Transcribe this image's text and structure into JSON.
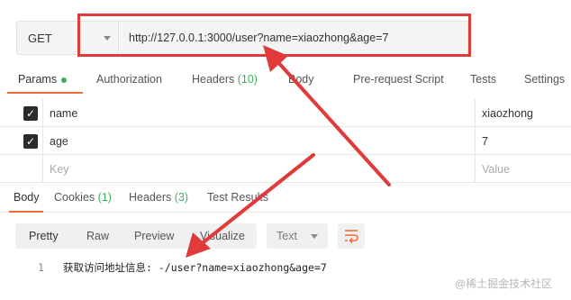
{
  "request": {
    "method": "GET",
    "url": "http://127.0.0.1:3000/user?name=xiaozhong&age=7"
  },
  "request_tabs": [
    {
      "label": "Params",
      "has_dot": true
    },
    {
      "label": "Authorization"
    },
    {
      "label": "Headers",
      "count": "(10)"
    },
    {
      "label": "Body"
    },
    {
      "label": "Pre-request Script"
    },
    {
      "label": "Tests"
    },
    {
      "label": "Settings"
    }
  ],
  "params": [
    {
      "checked": true,
      "key": "name",
      "value": "xiaozhong"
    },
    {
      "checked": true,
      "key": "age",
      "value": "7"
    }
  ],
  "params_placeholder": {
    "key": "Key",
    "value": "Value"
  },
  "response_tabs": [
    {
      "label": "Body"
    },
    {
      "label": "Cookies",
      "count": "(1)"
    },
    {
      "label": "Headers",
      "count": "(3)"
    },
    {
      "label": "Test Results"
    }
  ],
  "body_views": [
    "Pretty",
    "Raw",
    "Preview",
    "Visualize"
  ],
  "format_select": "Text",
  "response_body": [
    {
      "line": "1",
      "text": "获取访问地址信息: -/user?name=xiaozhong&age=7"
    }
  ],
  "watermark": "@稀土掘金技术社区",
  "colors": {
    "accent": "#f26b3a",
    "green": "#3cae5a",
    "annotation_red": "#e03a3a"
  }
}
